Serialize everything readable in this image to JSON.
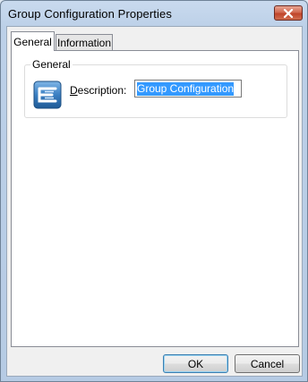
{
  "window": {
    "title": "Group Configuration Properties",
    "close_icon": "close-icon"
  },
  "tabs": [
    {
      "label": "General",
      "active": true
    },
    {
      "label": "Information",
      "active": false
    }
  ],
  "general_group": {
    "label": "General",
    "icon": "group-configuration-icon",
    "description_label_accesskey": "D",
    "description_label_rest": "escription:",
    "description_value": "Group Configuration"
  },
  "buttons": {
    "ok": "OK",
    "cancel": "Cancel"
  },
  "colors": {
    "selection": "#3399ff",
    "close_button": "#c0442a",
    "icon_blue": "#2f6ea8"
  }
}
